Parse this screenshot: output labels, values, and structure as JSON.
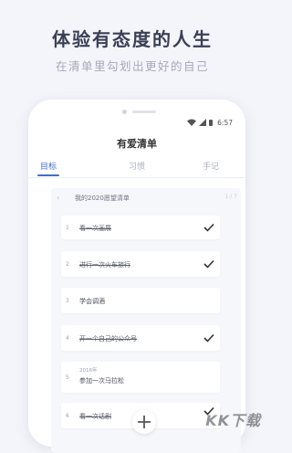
{
  "promo": {
    "headline": "体验有态度的人生",
    "subline": "在清单里勾划出更好的自己"
  },
  "status_bar": {
    "icons": [
      "wifi-icon",
      "signal-icon",
      "battery-icon"
    ],
    "time": "6:57"
  },
  "app": {
    "title": "有爱清单",
    "tabs": [
      {
        "label": "目标",
        "active": true
      },
      {
        "label": "习惯",
        "active": false
      },
      {
        "label": "手记",
        "active": false
      }
    ],
    "group": {
      "back_icon": "chevron-left-icon",
      "title": "我的2020愿望清单",
      "count": "1 / 7"
    },
    "items": [
      {
        "no": "1",
        "text": "看一次画展",
        "done": true
      },
      {
        "no": "2",
        "text": "进行一次火车旅行",
        "done": true
      },
      {
        "no": "3",
        "text": "学会调酒",
        "done": false
      },
      {
        "no": "4",
        "text": "开一个自己的公众号",
        "done": true
      },
      {
        "no": "5",
        "note": "2016年",
        "text": "参加一次马拉松",
        "done": false
      },
      {
        "no": "6",
        "text": "看一次话剧",
        "done": true
      }
    ],
    "add_button_icon": "plus-icon"
  },
  "watermark": "KK下载",
  "colors": {
    "accent": "#3f6ecf",
    "headline": "#3a3f55",
    "background": "#f4f5fa"
  }
}
